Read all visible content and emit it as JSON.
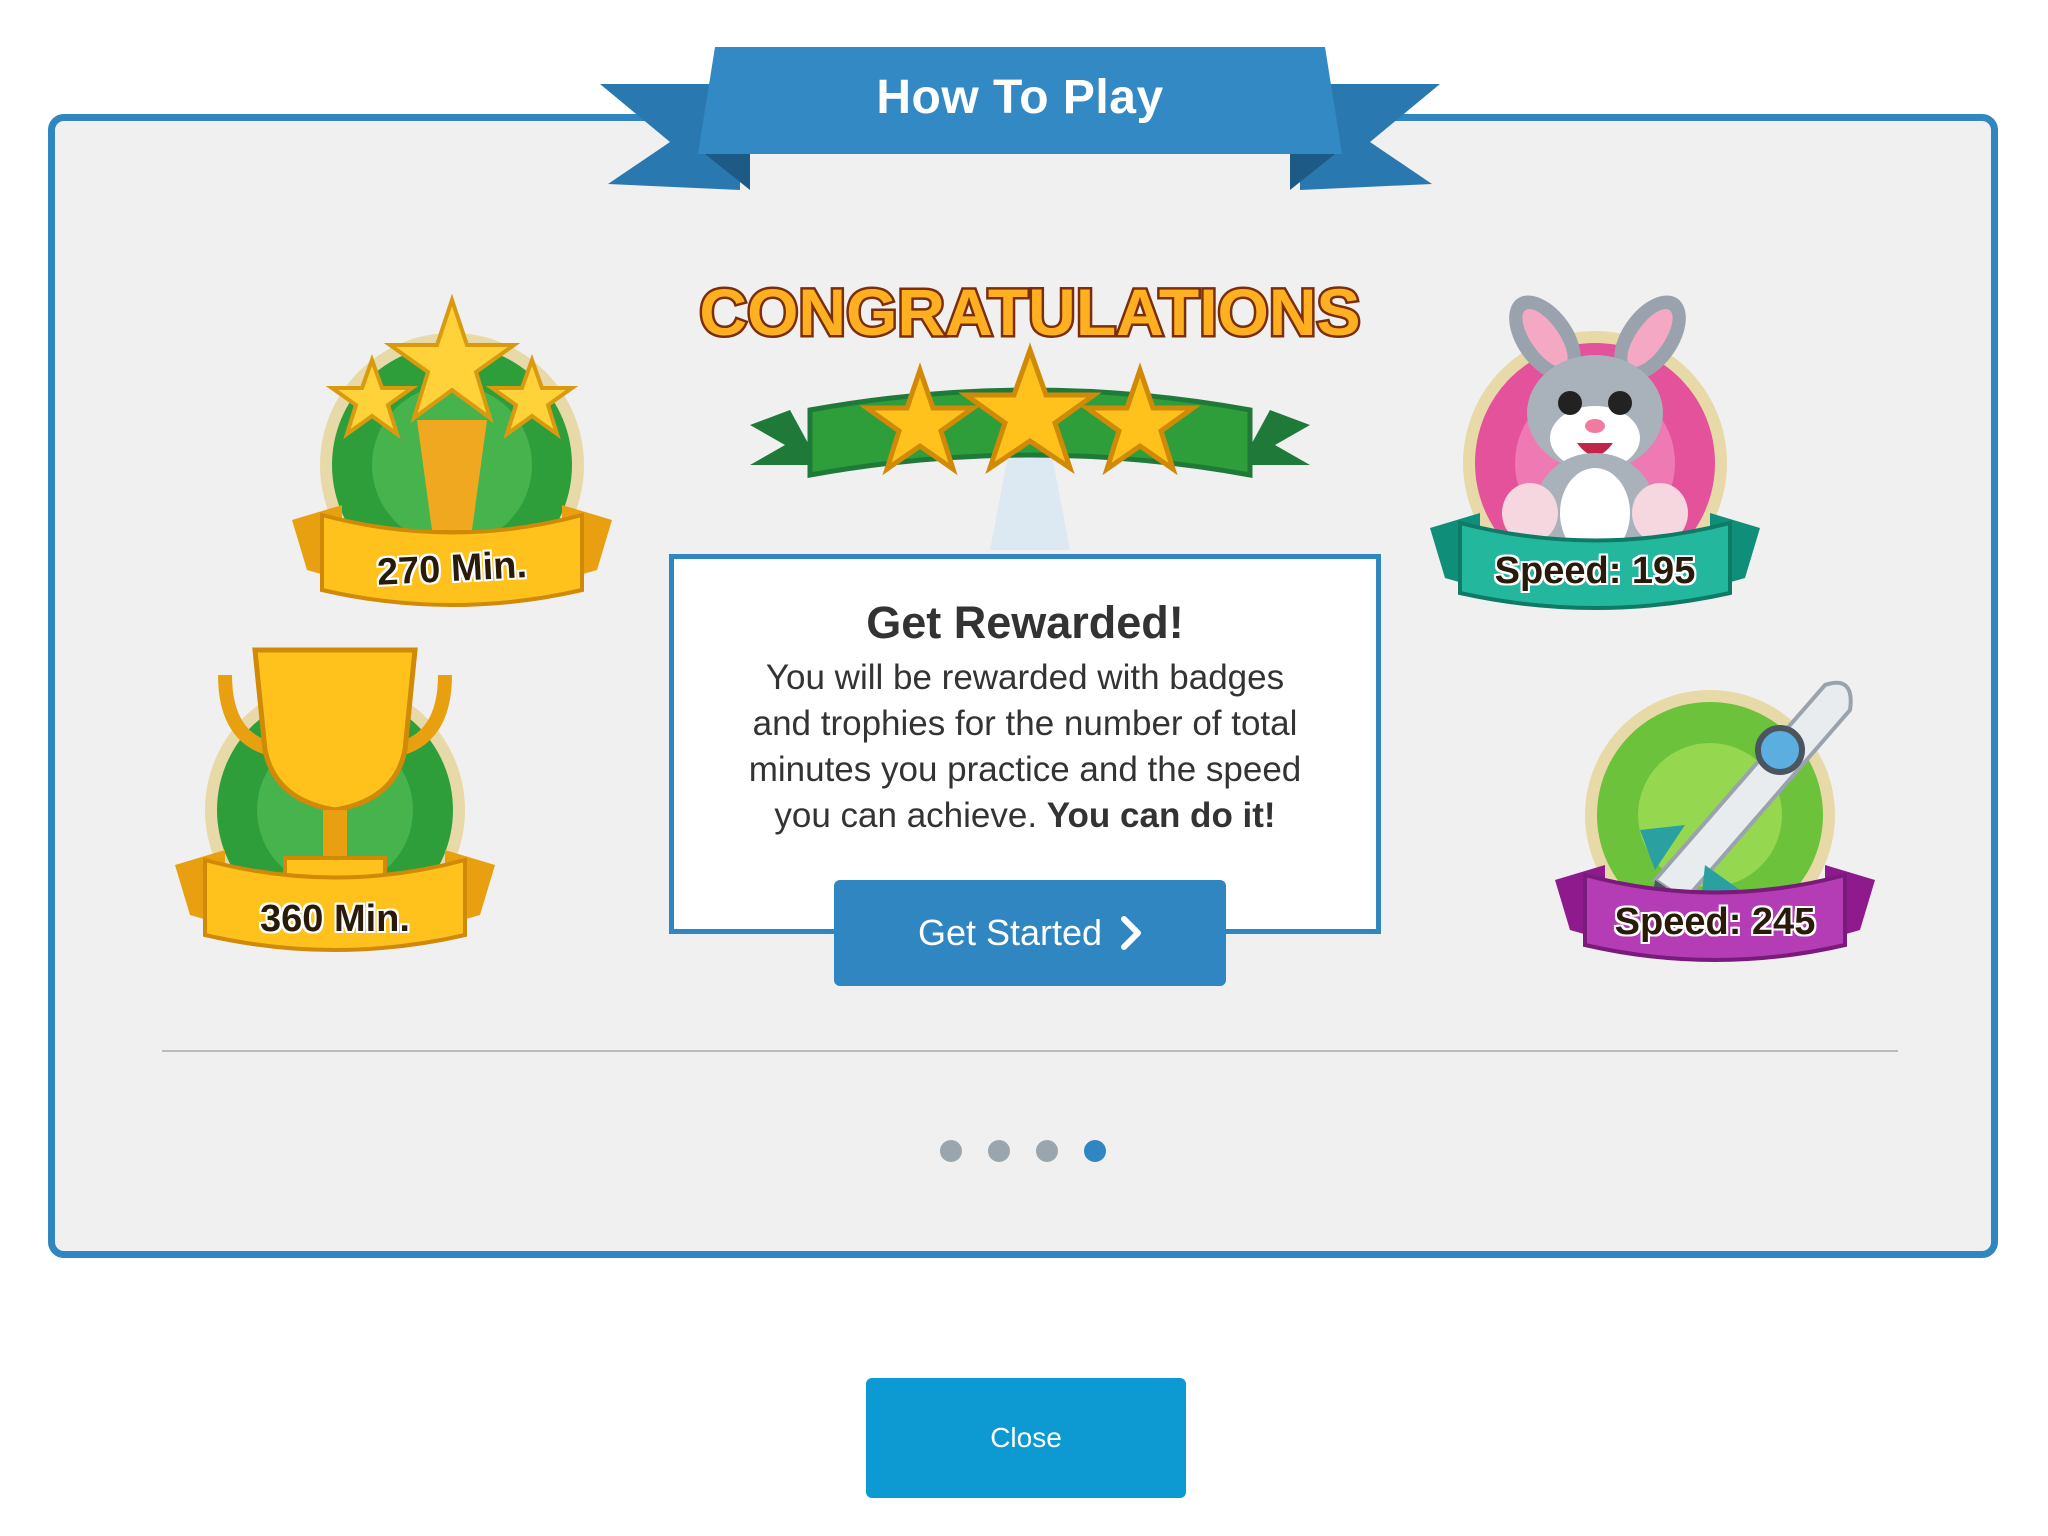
{
  "dialog": {
    "title": "How To Play",
    "congrats_text": "CONGRATULATIONS",
    "badges": {
      "trophy_stars": "270 Min.",
      "trophy_cup": "360 Min.",
      "bunny": "Speed: 195",
      "rocket": "Speed: 245"
    },
    "info": {
      "heading": "Get Rewarded!",
      "body_lines": [
        "You will be rewarded with badges",
        "and trophies for the number of total",
        "minutes you practice and the speed",
        "you can achieve."
      ],
      "emphasis": "You can do it!"
    },
    "start_button_label": "Get Started",
    "pager": {
      "total": 4,
      "current": 4
    },
    "close_button_label": "Close"
  },
  "colors": {
    "accent": "#2f86c0",
    "close_button": "#0d9ad2",
    "panel_bg": "#f0f0f0",
    "dot_inactive": "#9aa5ad"
  }
}
